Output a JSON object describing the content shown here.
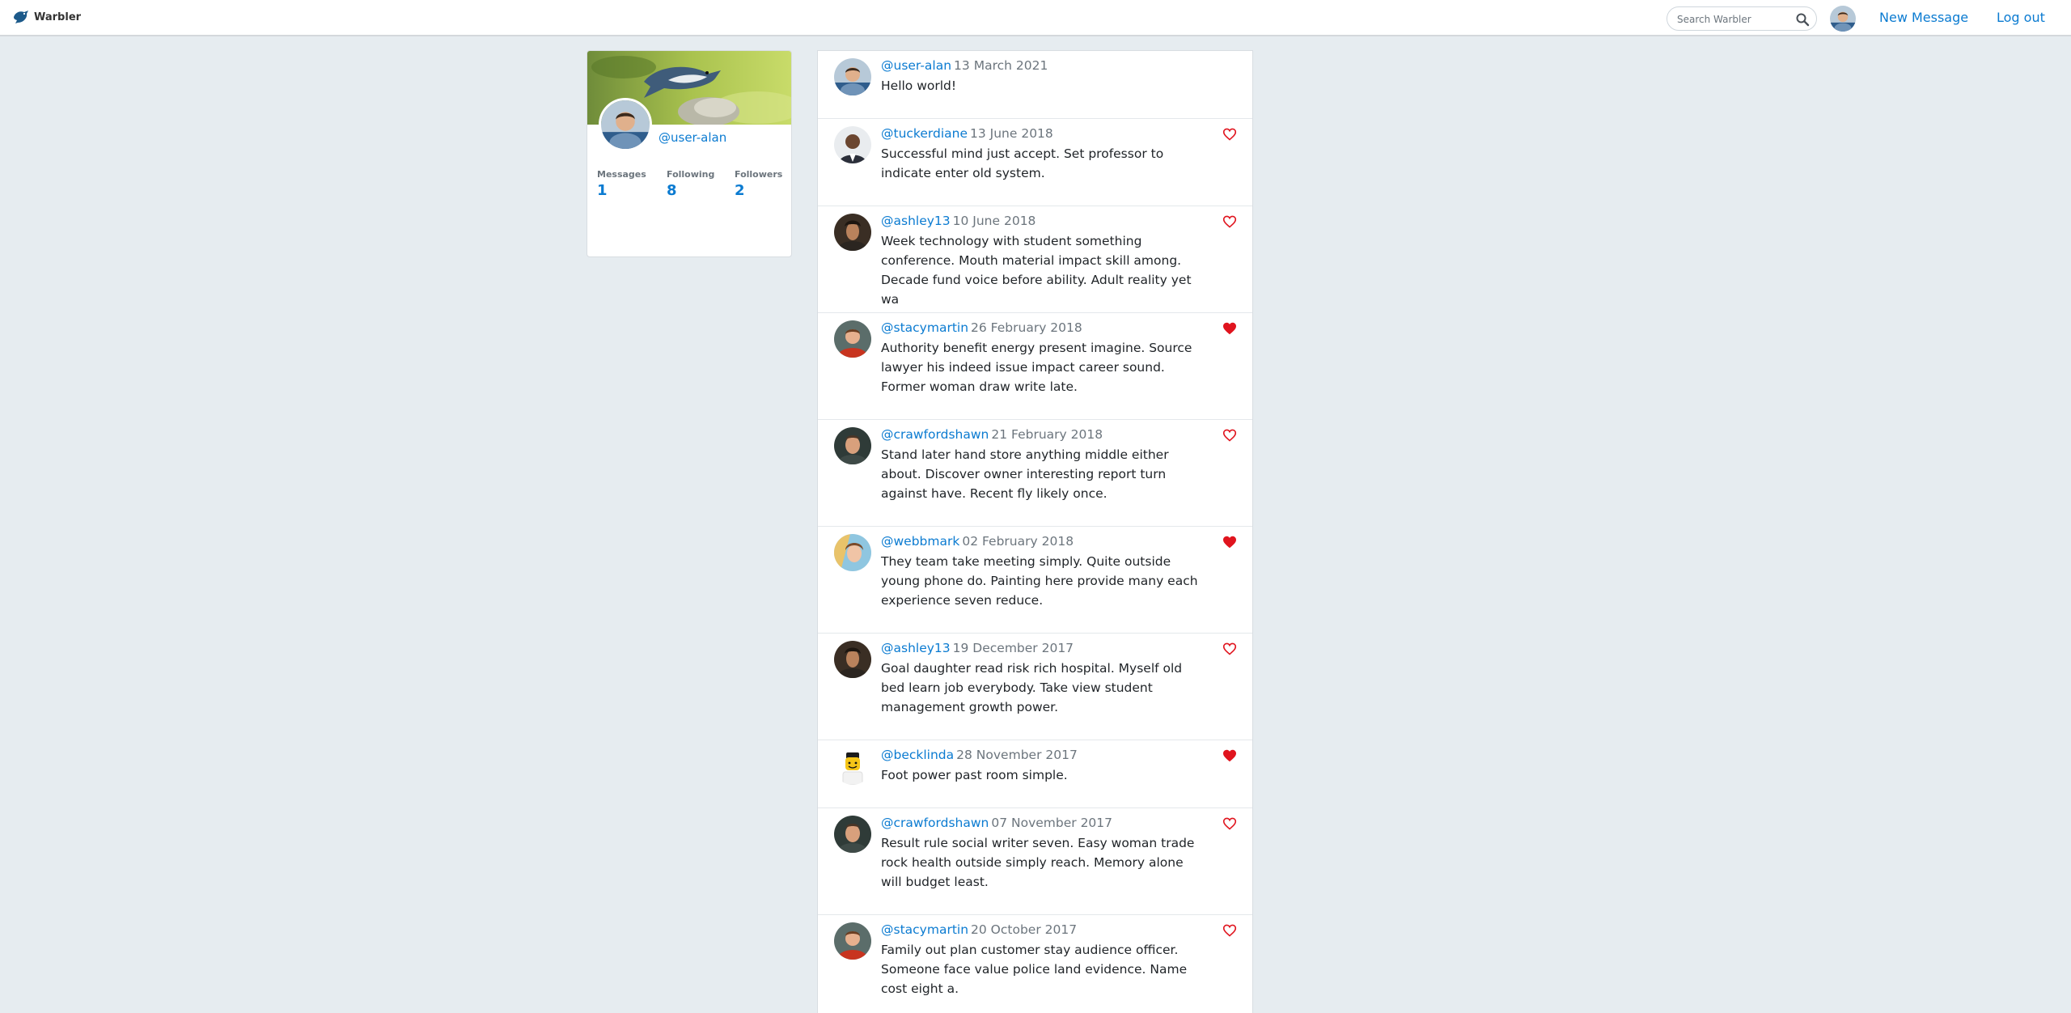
{
  "nav": {
    "brand_label": "Warbler",
    "search_placeholder": "Search Warbler",
    "new_message_label": "New Message",
    "logout_label": "Log out"
  },
  "profile": {
    "username": "@user-alan",
    "stats": [
      {
        "label": "Messages",
        "value": "1"
      },
      {
        "label": "Following",
        "value": "8"
      },
      {
        "label": "Followers",
        "value": "2"
      }
    ]
  },
  "messages": [
    {
      "user": "@user-alan",
      "date": "13 March 2021",
      "text": "Hello world!",
      "liked": null,
      "avatar": "avatar-user-alan"
    },
    {
      "user": "@tuckerdiane",
      "date": "13 June 2018",
      "text": "Successful mind just accept. Set professor to indicate enter old system.",
      "liked": false,
      "avatar": "avatar-tuckerdiane"
    },
    {
      "user": "@ashley13",
      "date": "10 June 2018",
      "text": "Week technology with student something conference. Mouth material impact skill among. Decade fund voice before ability. Adult reality yet wa",
      "liked": false,
      "avatar": "avatar-ashley13"
    },
    {
      "user": "@stacymartin",
      "date": "26 February 2018",
      "text": "Authority benefit energy present imagine. Source lawyer his indeed issue impact career sound. Former woman draw write late.",
      "liked": true,
      "avatar": "avatar-stacymartin"
    },
    {
      "user": "@crawfordshawn",
      "date": "21 February 2018",
      "text": "Stand later hand store anything middle either about. Discover owner interesting report turn against have. Recent fly likely once.",
      "liked": false,
      "avatar": "avatar-crawfordshawn"
    },
    {
      "user": "@webbmark",
      "date": "02 February 2018",
      "text": "They team take meeting simply. Quite outside young phone do. Painting here provide many each experience seven reduce.",
      "liked": true,
      "avatar": "avatar-webbmark"
    },
    {
      "user": "@ashley13",
      "date": "19 December 2017",
      "text": "Goal daughter read risk rich hospital. Myself old bed learn job everybody. Take view student management growth power.",
      "liked": false,
      "avatar": "avatar-ashley13"
    },
    {
      "user": "@becklinda",
      "date": "28 November 2017",
      "text": "Foot power past room simple.",
      "liked": true,
      "avatar": "avatar-becklinda"
    },
    {
      "user": "@crawfordshawn",
      "date": "07 November 2017",
      "text": "Result rule social writer seven. Easy woman trade rock health outside simply reach. Memory alone will budget least.",
      "liked": false,
      "avatar": "avatar-crawfordshawn"
    },
    {
      "user": "@stacymartin",
      "date": "20 October 2017",
      "text": "Family out plan customer stay audience officer. Someone face value police land evidence. Name cost eight a.",
      "liked": false,
      "avatar": "avatar-stacymartin"
    }
  ],
  "colors": {
    "link": "#0b7bd1",
    "like_red": "#e0141e",
    "page_bg": "#e6ecf0",
    "muted": "#6c757d"
  },
  "icons": {
    "brand": "bird-logo-icon",
    "search": "search-icon",
    "like_outline": "heart-outline-icon",
    "like_filled": "heart-filled-icon"
  }
}
